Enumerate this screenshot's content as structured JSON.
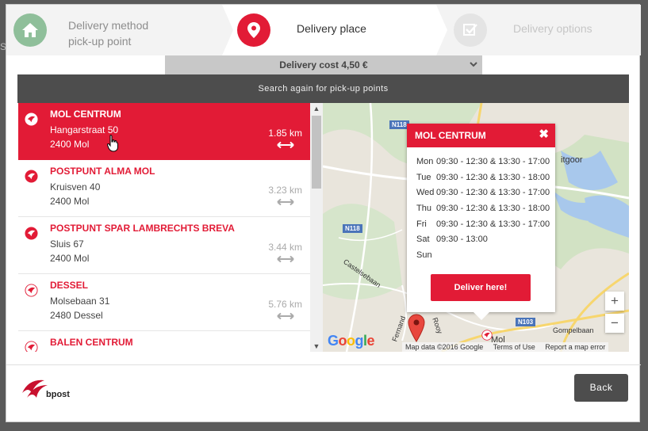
{
  "stepper": {
    "step1_line1": "Delivery method",
    "step1_line2": "pick-up point",
    "step2": "Delivery place",
    "step3": "Delivery options"
  },
  "delivery_cost": "Delivery cost 4,50 €",
  "search_again": "Search again for pick-up points",
  "points": [
    {
      "name": "MOL CENTRUM",
      "street": "Hangarstraat 50",
      "city": "2400 Mol",
      "distance": "1.85 km"
    },
    {
      "name": "POSTPUNT ALMA MOL",
      "street": "Kruisven 40",
      "city": "2400 Mol",
      "distance": "3.23 km"
    },
    {
      "name": "POSTPUNT SPAR LAMBRECHTS BREVA",
      "street": "Sluis 67",
      "city": "2400 Mol",
      "distance": "3.44 km"
    },
    {
      "name": "DESSEL",
      "street": "Molsebaan 31",
      "city": "2480 Dessel",
      "distance": "5.76 km"
    },
    {
      "name": "BALEN CENTRUM",
      "street": "",
      "city": "",
      "distance": ""
    }
  ],
  "popup": {
    "title": "MOL CENTRUM",
    "hours": [
      {
        "day": "Mon",
        "time": "09:30 - 12:30 & 13:30 - 17:00"
      },
      {
        "day": "Tue",
        "time": "09:30 - 12:30 & 13:30 - 18:00"
      },
      {
        "day": "Wed",
        "time": "09:30 - 12:30 & 13:30 - 17:00"
      },
      {
        "day": "Thu",
        "time": "09:30 - 12:30 & 13:30 - 18:00"
      },
      {
        "day": "Fri",
        "time": "09:30 - 12:30 & 13:30 - 17:00"
      },
      {
        "day": "Sat",
        "time": "09:30 - 13:00"
      },
      {
        "day": "Sun",
        "time": ""
      }
    ],
    "button": "Deliver here!"
  },
  "map": {
    "road_n118_a": "N118",
    "road_n118_b": "N118",
    "road_n103": "N103",
    "place_gitgoor": "itgoor",
    "place_castelsebaan": "Castelsebaan",
    "place_gompelbaan": "Gompelbaan",
    "place_mol": "Mol",
    "place_fernand": "Fernand",
    "place_rooy": "Rooy",
    "google": "Google",
    "attribution": "Map data ©2016 Google",
    "terms": "Terms of Use",
    "report": "Report a map error",
    "zoom_in": "+",
    "zoom_out": "−"
  },
  "back_label": "Back",
  "logo_text": "bpost",
  "colors": {
    "brand_red": "#e21b36",
    "dark": "#4d4d4d",
    "step_done": "#8fbf9a"
  }
}
